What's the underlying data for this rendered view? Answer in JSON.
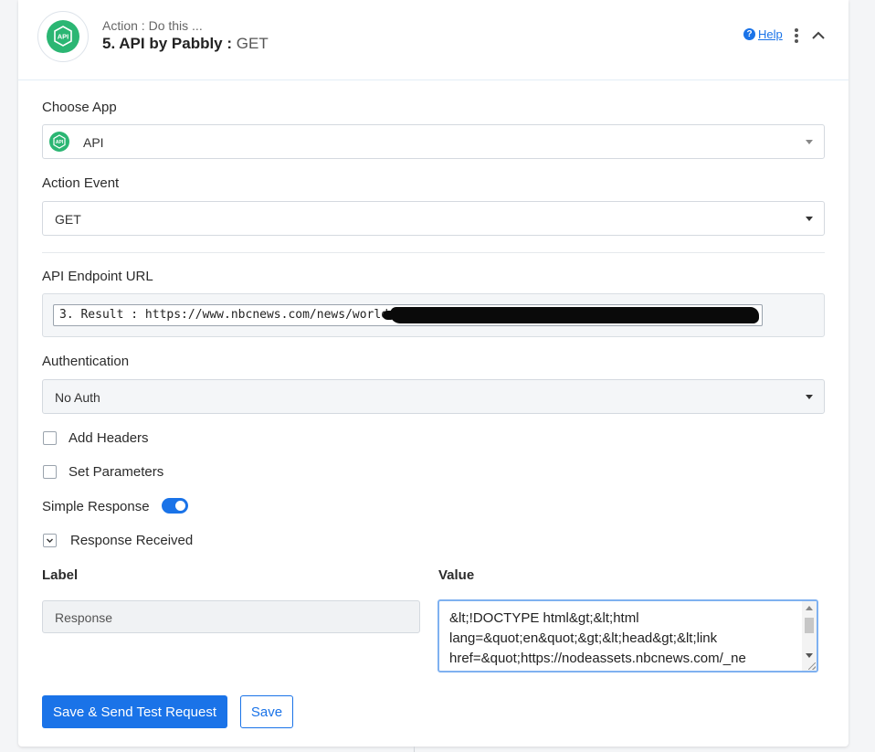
{
  "header": {
    "kicker": "Action : Do this ...",
    "title": "5. API by Pabbly :",
    "event": "GET",
    "help_label": "Help",
    "logo_text": "API"
  },
  "choose_app": {
    "label": "Choose App",
    "value": "API"
  },
  "action_event": {
    "label": "Action Event",
    "value": "GET"
  },
  "endpoint": {
    "label": "API Endpoint URL",
    "value": "3. Result : https://www.nbcnews.com/news/world/"
  },
  "authentication": {
    "label": "Authentication",
    "value": "No Auth"
  },
  "options": {
    "add_headers": "Add Headers",
    "set_parameters": "Set Parameters",
    "simple_response": "Simple Response",
    "simple_response_on": true,
    "response_received": "Response Received"
  },
  "mapping": {
    "label_header": "Label",
    "value_header": "Value",
    "label_value": "Response",
    "value_text": "&lt;!DOCTYPE html&gt;&lt;html\nlang=&quot;en&quot;&gt;&lt;head&gt;&lt;link\nhref=&quot;https://nodeassets.nbcnews.com/_ne"
  },
  "buttons": {
    "save_send": "Save & Send Test Request",
    "save": "Save"
  },
  "colors": {
    "accent": "#1a73e8",
    "app_green": "#2bb673"
  }
}
